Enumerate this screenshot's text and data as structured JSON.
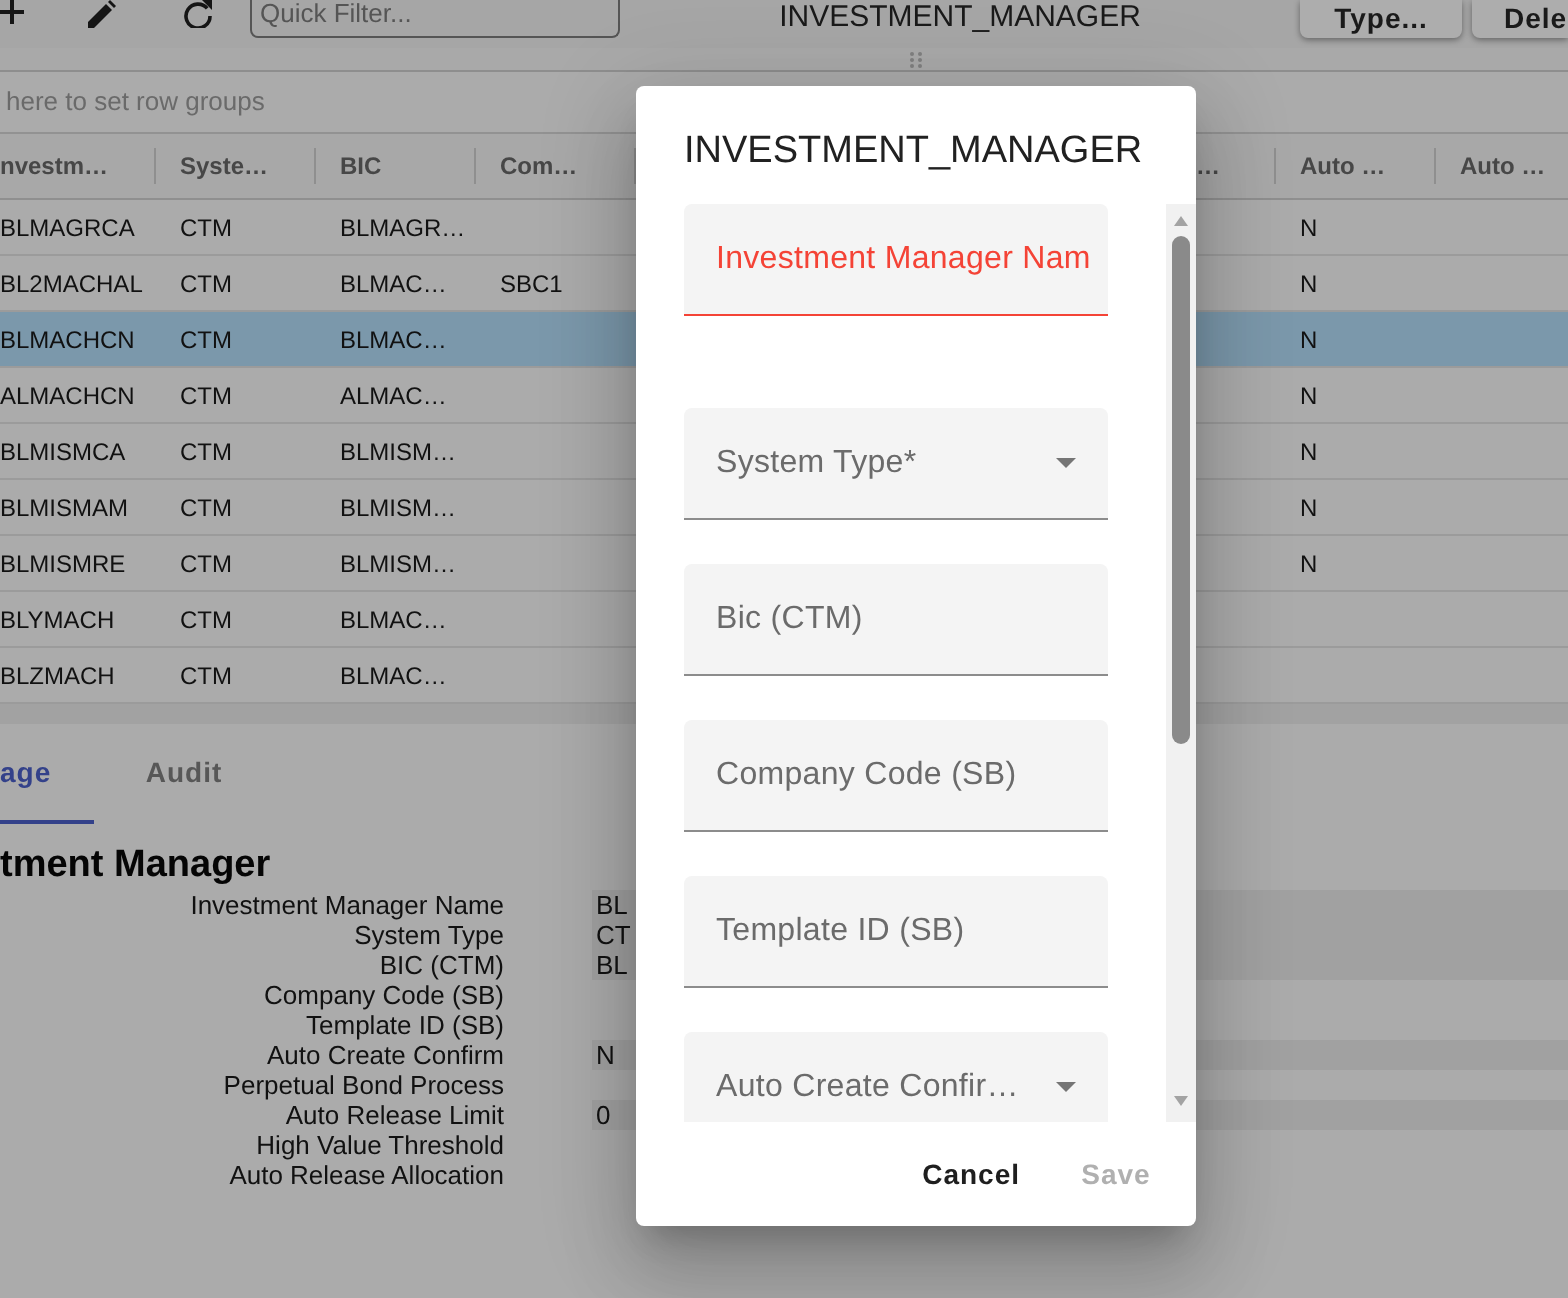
{
  "toolbar": {
    "quick_filter": {
      "placeholder": "Quick Filter..."
    },
    "title": "INVESTMENT_MANAGER",
    "buttons": [
      "Type...",
      "Dele"
    ]
  },
  "row_group_panel": {
    "hint": "here to set row groups"
  },
  "grid": {
    "columns": [
      "nvestm…",
      "Syste…",
      "BIC",
      "Com…",
      "…",
      "Auto …",
      "Auto …"
    ],
    "rows": [
      {
        "selected": false,
        "column_1": "BLMAGRCA",
        "column_2": "CTM",
        "column_3": "BLMAGR…",
        "column_6": "N"
      },
      {
        "selected": false,
        "column_1": "BL2MACHAL",
        "column_2": "CTM",
        "column_3": "BLMAC…",
        "column_4": "SBC1",
        "column_6": "N"
      },
      {
        "selected": true,
        "column_1": "BLMACHCN",
        "column_2": "CTM",
        "column_3": "BLMAC…",
        "column_6": "N"
      },
      {
        "selected": false,
        "column_1": "ALMACHCN",
        "column_2": "CTM",
        "column_3": "ALMAC…",
        "column_6": "N"
      },
      {
        "selected": false,
        "column_1": "BLMISMCA",
        "column_2": "CTM",
        "column_3": "BLMISM…",
        "column_6": "N"
      },
      {
        "selected": false,
        "column_1": "BLMISMAM",
        "column_2": "CTM",
        "column_3": "BLMISM…",
        "column_6": "N"
      },
      {
        "selected": false,
        "column_1": "BLMISMRE",
        "column_2": "CTM",
        "column_3": "BLMISM…",
        "column_6": "N"
      },
      {
        "selected": false,
        "column_1": "BLYMACH",
        "column_2": "CTM",
        "column_3": "BLMAC…"
      },
      {
        "selected": false,
        "column_1": "BLZMACH",
        "column_2": "CTM",
        "column_3": "BLMAC…"
      }
    ]
  },
  "detail": {
    "tabs": [
      {
        "label": "age",
        "selected": true
      },
      {
        "label": "Audit",
        "selected": false
      }
    ],
    "heading": "tment Manager",
    "fields": [
      {
        "label": "Investment Manager Name",
        "value": "BL"
      },
      {
        "label": "System Type",
        "value": "CT"
      },
      {
        "label": "BIC (CTM)",
        "value": "BL"
      },
      {
        "label": "Company Code (SB)"
      },
      {
        "label": "Template ID (SB)"
      },
      {
        "label": "Auto Create Confirm",
        "value": "N"
      },
      {
        "label": "Perpetual Bond Process"
      },
      {
        "label": "Auto Release Limit",
        "value": "0"
      },
      {
        "label": "High Value Threshold"
      },
      {
        "label": "Auto Release Allocation"
      }
    ]
  },
  "dialog": {
    "title": "INVESTMENT_MANAGER",
    "fields": [
      {
        "kind": "text",
        "placeholder": "Investment Manager Nam",
        "error": true
      },
      {
        "kind": "select",
        "label": "System Type*",
        "error": false
      },
      {
        "kind": "text",
        "placeholder": "Bic (CTM)",
        "error": false
      },
      {
        "kind": "text",
        "placeholder": "Company Code (SB)",
        "error": false
      },
      {
        "kind": "text",
        "placeholder": "Template ID (SB)",
        "error": false
      },
      {
        "kind": "select",
        "label": "Auto Create Confir…",
        "error": false
      }
    ],
    "actions": [
      {
        "label": "Cancel",
        "disabled": false
      },
      {
        "label": "Save",
        "disabled": true
      }
    ]
  }
}
